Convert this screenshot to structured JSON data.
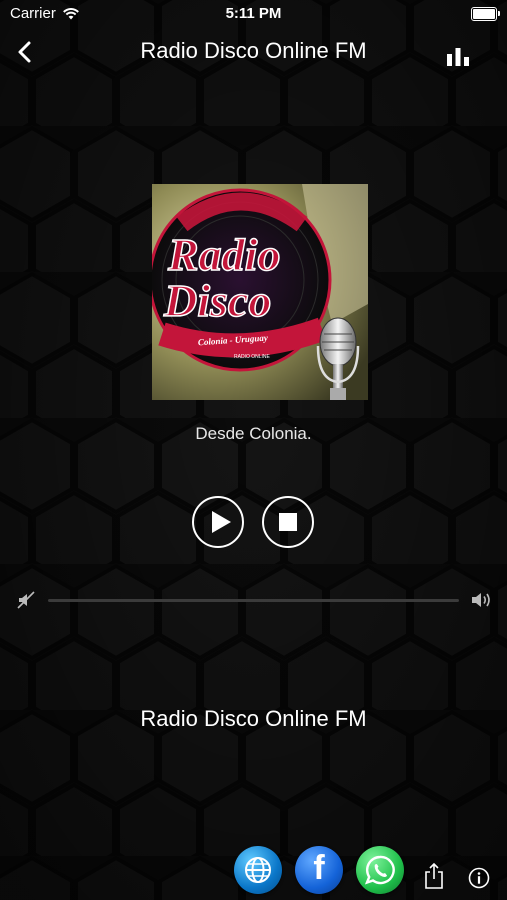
{
  "status_bar": {
    "carrier": "Carrier",
    "time": "5:11 PM"
  },
  "nav": {
    "title": "Radio Disco Online FM",
    "back_icon": "chevron-left-icon",
    "eq_icon": "bar-chart-icon"
  },
  "album_art": {
    "title_line1": "Radio",
    "title_line2": "Disco",
    "subtitle": "Colonia - Uruguay",
    "tagline": "RADIO ONLINE",
    "accent": "#c3153a"
  },
  "slogan": "Desde Colonia.",
  "player": {
    "play_icon": "play-icon",
    "stop_icon": "stop-icon"
  },
  "volume": {
    "min_icon": "volume-mute-icon",
    "max_icon": "volume-high-icon"
  },
  "station_name": "Radio Disco Online FM",
  "footer": {
    "web_icon": "globe-icon",
    "facebook_letter": "f",
    "whatsapp_icon": "whatsapp-icon",
    "share_icon": "share-icon",
    "info_icon": "info-icon"
  },
  "colors": {
    "background": "#0b0b0b",
    "text": "#ffffff"
  }
}
